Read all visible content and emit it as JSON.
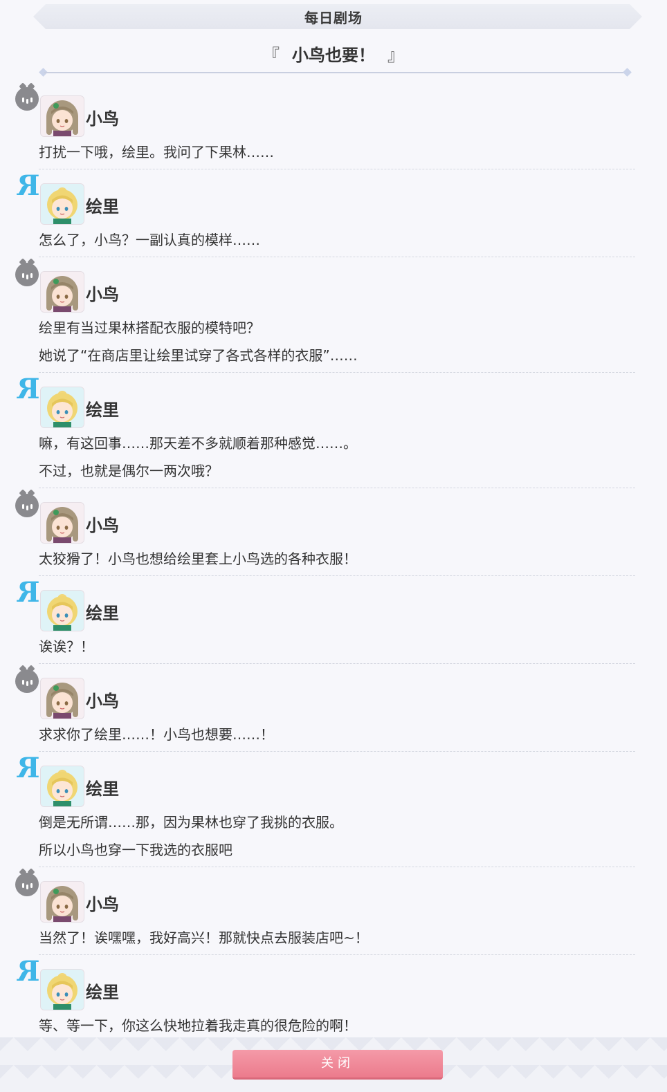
{
  "header": {
    "title": "每日剧场"
  },
  "episode": {
    "title": "小鸟也要！",
    "open_bracket": "『",
    "close_bracket": "』"
  },
  "colors": {
    "accent_blue": "#3fb6e8",
    "button_pink": "#ec7b8c"
  },
  "entries": [
    {
      "speaker": "小鸟",
      "group_icon": "bibi-icon",
      "avatar": "kotori-avatar",
      "lines": [
        "打扰一下哦，绘里。我问了下果林……"
      ]
    },
    {
      "speaker": "绘里",
      "group_icon": "lily-white-icon",
      "avatar": "eli-avatar",
      "lines": [
        "怎么了，小鸟？一副认真的模样……"
      ]
    },
    {
      "speaker": "小鸟",
      "group_icon": "bibi-icon",
      "avatar": "kotori-avatar",
      "lines": [
        "绘里有当过果林搭配衣服的模特吧？",
        "她说了“在商店里让绘里试穿了各式各样的衣服”……"
      ]
    },
    {
      "speaker": "绘里",
      "group_icon": "lily-white-icon",
      "avatar": "eli-avatar",
      "lines": [
        "嘛，有这回事……那天差不多就顺着那种感觉……。",
        "不过，也就是偶尔一两次哦？"
      ]
    },
    {
      "speaker": "小鸟",
      "group_icon": "bibi-icon",
      "avatar": "kotori-avatar",
      "lines": [
        "太狡猾了！小鸟也想给绘里套上小鸟选的各种衣服！"
      ]
    },
    {
      "speaker": "绘里",
      "group_icon": "lily-white-icon",
      "avatar": "eli-avatar",
      "lines": [
        "诶诶？！"
      ]
    },
    {
      "speaker": "小鸟",
      "group_icon": "bibi-icon",
      "avatar": "kotori-avatar",
      "lines": [
        "求求你了绘里……！小鸟也想要……！"
      ]
    },
    {
      "speaker": "绘里",
      "group_icon": "lily-white-icon",
      "avatar": "eli-avatar",
      "lines": [
        "倒是无所谓……那，因为果林也穿了我挑的衣服。",
        "所以小鸟也穿一下我选的衣服吧"
      ]
    },
    {
      "speaker": "小鸟",
      "group_icon": "bibi-icon",
      "avatar": "kotori-avatar",
      "lines": [
        "当然了！诶嘿嘿，我好高兴！那就快点去服装店吧~！"
      ]
    },
    {
      "speaker": "绘里",
      "group_icon": "lily-white-icon",
      "avatar": "eli-avatar",
      "lines": [
        "等、等一下，你这么快地拉着我走真的很危险的啊！"
      ]
    }
  ],
  "footer": {
    "close_label": "关闭"
  }
}
